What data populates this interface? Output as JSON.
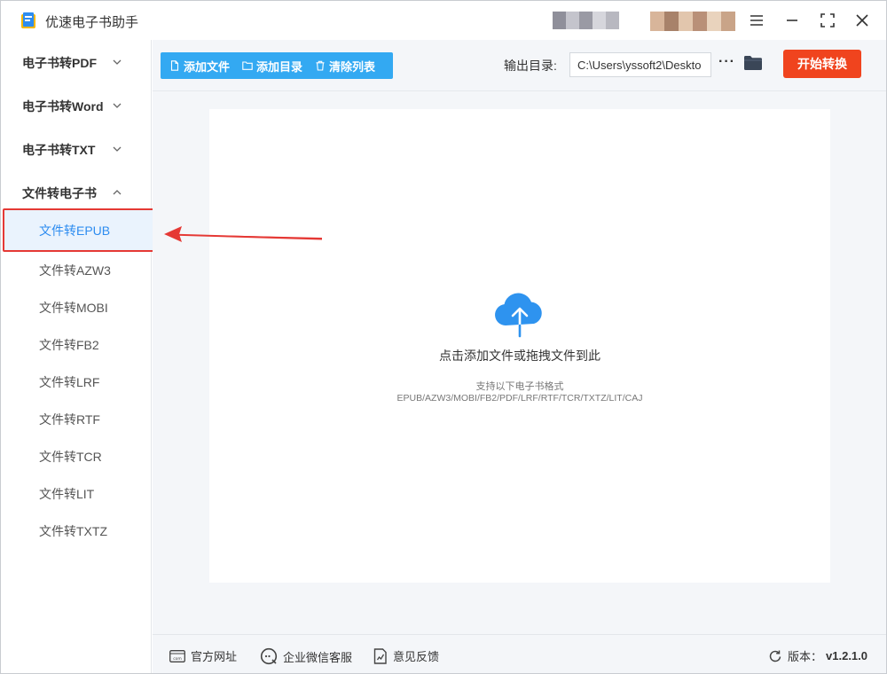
{
  "app": {
    "title": "优速电子书助手"
  },
  "sidebar": {
    "groups": [
      {
        "label": "电子书转PDF"
      },
      {
        "label": "电子书转Word"
      },
      {
        "label": "电子书转TXT"
      },
      {
        "label": "文件转电子书"
      }
    ],
    "sub_items": [
      {
        "label": "文件转EPUB"
      },
      {
        "label": "文件转AZW3"
      },
      {
        "label": "文件转MOBI"
      },
      {
        "label": "文件转FB2"
      },
      {
        "label": "文件转LRF"
      },
      {
        "label": "文件转RTF"
      },
      {
        "label": "文件转TCR"
      },
      {
        "label": "文件转LIT"
      },
      {
        "label": "文件转TXTZ"
      }
    ]
  },
  "toolbar": {
    "add_file": "添加文件",
    "add_folder": "添加目录",
    "clear_list": "清除列表",
    "output_label": "输出目录:",
    "output_path": "C:\\Users\\yssoft2\\Deskto",
    "more": "···",
    "start": "开始转换"
  },
  "dropzone": {
    "text": "点击添加文件或拖拽文件到此",
    "formats_title": "支持以下电子书格式",
    "formats": "EPUB/AZW3/MOBI/FB2/PDF/LRF/RTF/TCR/TXTZ/LIT/CAJ"
  },
  "footer": {
    "website": "官方网址",
    "wechat": "企业微信客服",
    "feedback": "意见反馈",
    "version_label": "版本：",
    "version": "v1.2.1.0"
  },
  "colors": {
    "accent": "#2d8cf0",
    "toolbar_button": "#33a9f2",
    "start_button": "#f0441e",
    "highlight": "#e53935"
  }
}
